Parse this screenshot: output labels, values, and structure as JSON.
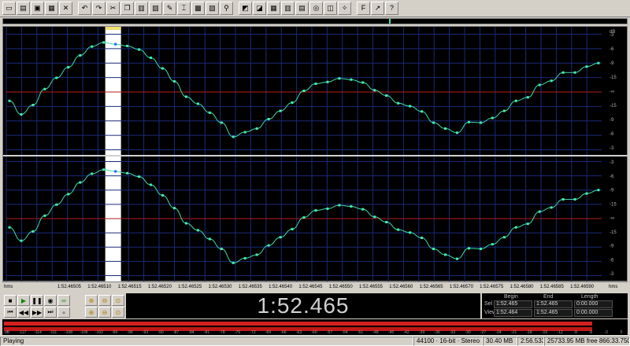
{
  "toolbar": {
    "buttons": [
      {
        "name": "new-file-icon",
        "glyph": "▭"
      },
      {
        "name": "open-file-icon",
        "glyph": "▤"
      },
      {
        "name": "save-file-icon",
        "glyph": "▣"
      },
      {
        "name": "properties-icon",
        "glyph": "▦"
      },
      {
        "name": "close-icon",
        "glyph": "✕"
      },
      {
        "name": "sep"
      },
      {
        "name": "undo-icon",
        "glyph": "↶"
      },
      {
        "name": "redo-icon",
        "glyph": "↷"
      },
      {
        "name": "cut-icon",
        "glyph": "✂"
      },
      {
        "name": "copy-icon",
        "glyph": "❐"
      },
      {
        "name": "paste-icon",
        "glyph": "▥"
      },
      {
        "name": "paste-mix-icon",
        "glyph": "▧"
      },
      {
        "name": "pencil-icon",
        "glyph": "✎"
      },
      {
        "name": "trim-icon",
        "glyph": "⌶"
      },
      {
        "name": "effect-icon",
        "glyph": "▩"
      },
      {
        "name": "marker-icon",
        "glyph": "▨"
      },
      {
        "name": "scrub-icon",
        "glyph": "⚲"
      },
      {
        "name": "sep"
      },
      {
        "name": "spectrum-icon",
        "glyph": "◩"
      },
      {
        "name": "frequency-icon",
        "glyph": "◪"
      },
      {
        "name": "grid-icon",
        "glyph": "▦"
      },
      {
        "name": "bars-icon",
        "glyph": "▥"
      },
      {
        "name": "columns-icon",
        "glyph": "▤"
      },
      {
        "name": "loop-icon",
        "glyph": "◎"
      },
      {
        "name": "script-icon",
        "glyph": "◫"
      },
      {
        "name": "wand-icon",
        "glyph": "✧"
      },
      {
        "name": "sep"
      },
      {
        "name": "font-icon",
        "glyph": "F"
      },
      {
        "name": "tools-icon",
        "glyph": "↗"
      },
      {
        "name": "help-icon",
        "glyph": "?"
      }
    ]
  },
  "waveform": {
    "units_label": "dB",
    "ch1_scale": [
      "-3",
      "-6",
      "-9",
      "-15",
      "-∞",
      "-15",
      "-9",
      "-6",
      "-3"
    ],
    "ch2_scale": [
      "-3",
      "-6",
      "-9",
      "-15",
      "-∞",
      "-15",
      "-9",
      "-6",
      "-3"
    ],
    "ch1_samples": [
      -0.15,
      -0.38,
      -0.22,
      0.05,
      0.24,
      0.42,
      0.62,
      0.77,
      0.84,
      0.81,
      0.78,
      0.72,
      0.58,
      0.4,
      0.18,
      -0.08,
      -0.2,
      -0.35,
      -0.52,
      -0.76,
      -0.68,
      -0.62,
      -0.46,
      -0.32,
      -0.18,
      0.02,
      0.14,
      0.17,
      0.23,
      0.21,
      0.16,
      0.03,
      -0.06,
      -0.19,
      -0.24,
      -0.33,
      -0.52,
      -0.62,
      -0.69,
      -0.51,
      -0.52,
      -0.44,
      -0.32,
      -0.15,
      -0.09,
      0.12,
      0.19,
      0.33,
      0.33,
      0.43,
      0.49
    ],
    "ch2_samples": [
      -0.15,
      -0.38,
      -0.22,
      0.05,
      0.24,
      0.42,
      0.62,
      0.77,
      0.84,
      0.81,
      0.78,
      0.72,
      0.58,
      0.4,
      0.18,
      -0.08,
      -0.2,
      -0.35,
      -0.52,
      -0.76,
      -0.68,
      -0.62,
      -0.46,
      -0.32,
      -0.18,
      0.02,
      0.14,
      0.17,
      0.23,
      0.21,
      0.16,
      0.03,
      -0.06,
      -0.19,
      -0.24,
      -0.33,
      -0.52,
      -0.62,
      -0.69,
      -0.51,
      -0.52,
      -0.44,
      -0.32,
      -0.15,
      -0.09,
      0.12,
      0.19,
      0.33,
      0.33,
      0.43,
      0.49
    ],
    "selected_sample_index": 9,
    "colors": {
      "wave": "#40d8a8",
      "point": "#40f0b0",
      "grid": "#1a2a7a",
      "centerline": "#b02020",
      "divider": "#d0d0d0"
    }
  },
  "ruler": {
    "unit": "hms",
    "labels": [
      "1:52.46505",
      "1:52.46510",
      "1:52.46515",
      "1:52.46520",
      "1:52.46525",
      "1:52.46530",
      "1:52.46535",
      "1:52.46540",
      "1:52.46545",
      "1:52.46550",
      "1:52.46555",
      "1:52.46560",
      "1:52.46565",
      "1:52.46570",
      "1:52.46575",
      "1:52.46580",
      "1:52.46585",
      "1:52.46590"
    ],
    "unit_right": "hms"
  },
  "transport": {
    "time": "1:52.465"
  },
  "selection": {
    "head_begin": "Begin",
    "head_end": "End",
    "head_length": "Length",
    "sel_label": "Sel",
    "view_label": "View",
    "sel_begin": "1:52.465",
    "sel_end": "1:52.465",
    "sel_length": "0:00.000",
    "view_begin": "1:52.464",
    "view_end": "1:52.465",
    "view_length": "0:00.000"
  },
  "meter": {
    "labels": [
      "dB",
      "-117",
      "-114",
      "-111",
      "-108",
      "-105",
      "-102",
      "-99",
      "-96",
      "-93",
      "-90",
      "-87",
      "-84",
      "-81",
      "-78",
      "-75",
      "-72",
      "-69",
      "-66",
      "-63",
      "-60",
      "-57",
      "-54",
      "-51",
      "-48",
      "-45",
      "-42",
      "-39",
      "-36",
      "-33",
      "-30",
      "-27",
      "-24",
      "-21",
      "-18",
      "-15",
      "-12",
      "-9",
      "-6",
      "-3",
      "0"
    ],
    "level_fraction": 0.945
  },
  "status": {
    "state": "Playing",
    "sample_format": "44100 · 16-bit · Stereo",
    "file_size": "30.40 MB",
    "duration": "2:56.533",
    "free_space": "25733.95 MB free",
    "free_time": "866:33.750 free"
  }
}
